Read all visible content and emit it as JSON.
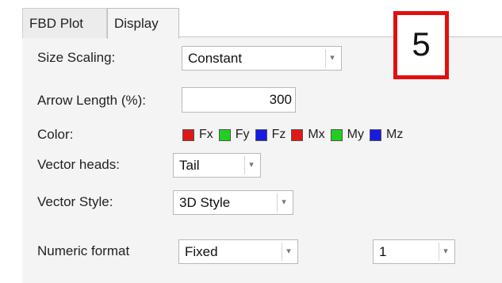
{
  "tabs": [
    {
      "label": "FBD Plot"
    },
    {
      "label": "Display"
    }
  ],
  "badge": {
    "text": "5",
    "color": "#e01010"
  },
  "fields": {
    "size_scaling": {
      "label": "Size Scaling:",
      "value": "Constant"
    },
    "arrow_length": {
      "label": "Arrow Length (%):",
      "value": "300"
    },
    "color": {
      "label": "Color:",
      "items": [
        {
          "name": "Fx",
          "color": "#e01818"
        },
        {
          "name": "Fy",
          "color": "#20d020"
        },
        {
          "name": "Fz",
          "color": "#1a1ae0"
        },
        {
          "name": "Mx",
          "color": "#e01818"
        },
        {
          "name": "My",
          "color": "#20d020"
        },
        {
          "name": "Mz",
          "color": "#1a1ae0"
        }
      ]
    },
    "vector_heads": {
      "label": "Vector heads:",
      "value": "Tail"
    },
    "vector_style": {
      "label": "Vector Style:",
      "value": "3D Style"
    },
    "numeric_format": {
      "label": "Numeric format",
      "value": "Fixed",
      "precision": "1"
    }
  },
  "icons": {
    "dropdown_arrow": "chevron-down-icon"
  }
}
